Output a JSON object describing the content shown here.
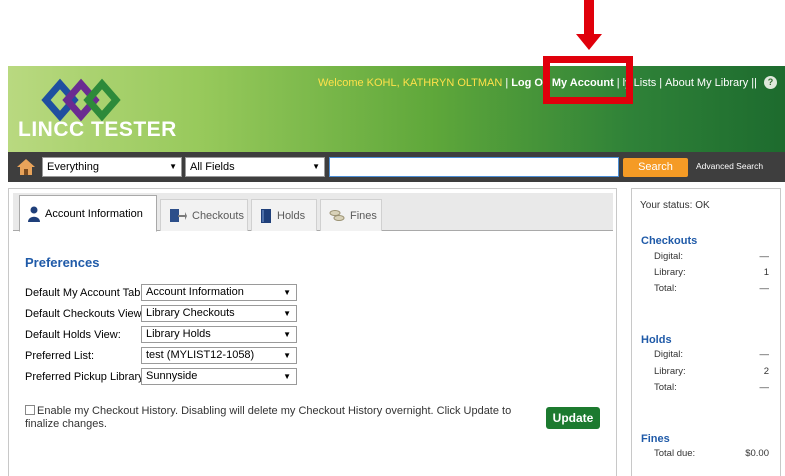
{
  "header": {
    "site_title": "LINCC TESTER",
    "welcome": "Welcome KOHL, KATHRYN OLTMAN",
    "log_out": "Log O",
    "my_account": "My Account",
    "my_lists": "ly Lists",
    "about": "About My Library",
    "help": "?"
  },
  "search": {
    "scope": "Everything",
    "field": "All Fields",
    "query": "",
    "button": "Search",
    "advanced": "Advanced Search"
  },
  "tabs": [
    {
      "label": "Account Information",
      "icon": "person-icon"
    },
    {
      "label": "Checkouts",
      "icon": "book-arrow-icon"
    },
    {
      "label": "Holds",
      "icon": "book-icon"
    },
    {
      "label": "Fines",
      "icon": "coins-icon"
    }
  ],
  "preferences": {
    "title": "Preferences",
    "rows": [
      {
        "label": "Default My Account Tab:",
        "value": "Account Information"
      },
      {
        "label": "Default Checkouts View:",
        "value": "Library Checkouts"
      },
      {
        "label": "Default Holds View:",
        "value": "Library Holds"
      },
      {
        "label": "Preferred List:",
        "value": "test (MYLIST12-1058)"
      },
      {
        "label": "Preferred Pickup Library:",
        "value": "Sunnyside"
      }
    ],
    "history_text": "Enable my Checkout History. Disabling will delete my Checkout History overnight. Click Update to finalize changes.",
    "update": "Update"
  },
  "sidebar": {
    "status": "Your status: OK",
    "checkouts": {
      "title": "Checkouts",
      "digital_label": "Digital:",
      "digital_value": "—",
      "library_label": "Library:",
      "library_value": "1",
      "total_label": "Total:",
      "total_value": "—"
    },
    "holds": {
      "title": "Holds",
      "digital_label": "Digital:",
      "digital_value": "—",
      "library_label": "Library:",
      "library_value": "2",
      "total_label": "Total:",
      "total_value": "—"
    },
    "fines": {
      "title": "Fines",
      "due_label": "Total due:",
      "due_value": "$0.00"
    }
  },
  "colors": {
    "annotation": "#e0000b",
    "brand_green": "#1c7a2f",
    "search_orange": "#f59b25",
    "link_blue": "#1f5aa8"
  }
}
